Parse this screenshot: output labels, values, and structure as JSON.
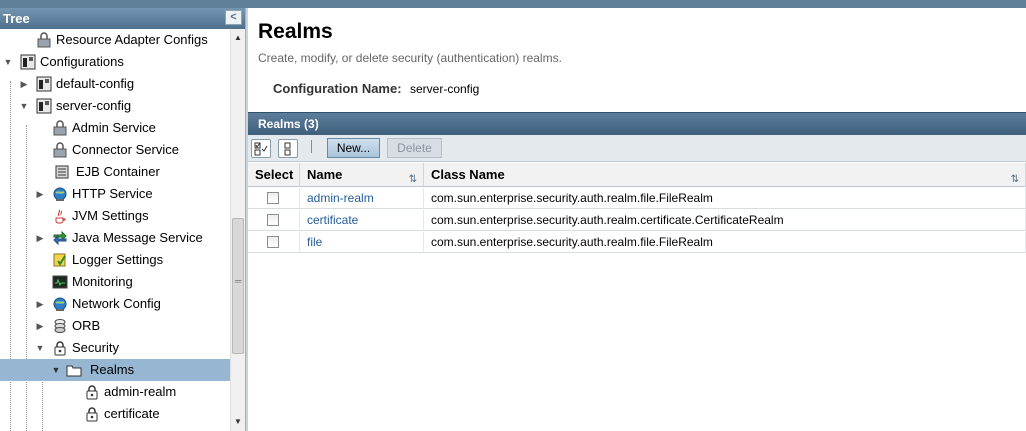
{
  "tree": {
    "title": "Tree",
    "collapse_glyph": "<",
    "items": [
      {
        "label": "Resource Adapter Configs",
        "icon": "lock-icon",
        "toggle": ""
      },
      {
        "label": "Configurations",
        "icon": "config-icon",
        "toggle": "▼"
      },
      {
        "label": "default-config",
        "icon": "config-icon",
        "toggle": "▶"
      },
      {
        "label": "server-config",
        "icon": "config-icon",
        "toggle": "▼"
      },
      {
        "label": "Admin Service",
        "icon": "lock-icon",
        "toggle": ""
      },
      {
        "label": "Connector Service",
        "icon": "lock-icon",
        "toggle": ""
      },
      {
        "label": "EJB Container",
        "icon": "container-icon",
        "toggle": ""
      },
      {
        "label": "HTTP Service",
        "icon": "globe-icon",
        "toggle": "▶"
      },
      {
        "label": "JVM Settings",
        "icon": "java-icon",
        "toggle": ""
      },
      {
        "label": "Java Message Service",
        "icon": "message-icon",
        "toggle": "▶"
      },
      {
        "label": "Logger Settings",
        "icon": "logger-icon",
        "toggle": ""
      },
      {
        "label": "Monitoring",
        "icon": "monitor-icon",
        "toggle": ""
      },
      {
        "label": "Network Config",
        "icon": "globe-icon",
        "toggle": "▶"
      },
      {
        "label": "ORB",
        "icon": "orb-icon",
        "toggle": "▶"
      },
      {
        "label": "Security",
        "icon": "padlock-icon",
        "toggle": "▼"
      },
      {
        "label": "Realms",
        "icon": "folder-icon",
        "toggle": "▼"
      },
      {
        "label": "admin-realm",
        "icon": "padlock-icon",
        "toggle": ""
      },
      {
        "label": "certificate",
        "icon": "padlock-icon",
        "toggle": ""
      }
    ]
  },
  "page": {
    "title": "Realms",
    "description": "Create, modify, or delete security (authentication) realms.",
    "config_label": "Configuration Name:",
    "config_value": "server-config"
  },
  "table": {
    "title": "Realms (3)",
    "new_label": "New...",
    "delete_label": "Delete",
    "columns": [
      "Select",
      "Name",
      "Class Name"
    ],
    "rows": [
      {
        "name": "admin-realm",
        "class_name": "com.sun.enterprise.security.auth.realm.file.FileRealm"
      },
      {
        "name": "certificate",
        "class_name": "com.sun.enterprise.security.auth.realm.certificate.CertificateRealm"
      },
      {
        "name": "file",
        "class_name": "com.sun.enterprise.security.auth.realm.file.FileRealm"
      }
    ]
  },
  "colors": {
    "header_blue": "#4f708c",
    "selected_row": "#96b6d1",
    "link": "#235d9a"
  }
}
